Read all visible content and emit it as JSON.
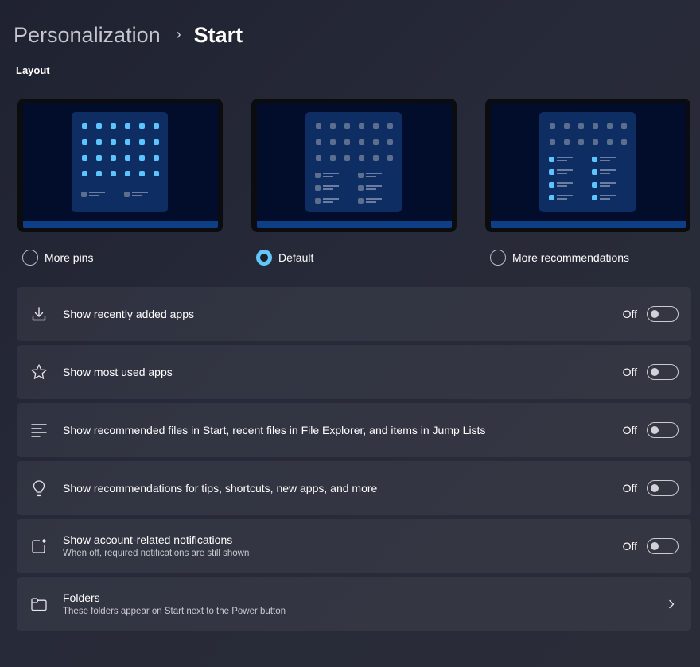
{
  "breadcrumb": {
    "parent": "Personalization",
    "separator": "›",
    "current": "Start"
  },
  "layout": {
    "section_title": "Layout",
    "options": [
      {
        "label": "More pins",
        "selected": false
      },
      {
        "label": "Default",
        "selected": true
      },
      {
        "label": "More recommendations",
        "selected": false
      }
    ]
  },
  "settings": [
    {
      "title": "Show recently added apps",
      "state": "Off",
      "icon": "download-icon"
    },
    {
      "title": "Show most used apps",
      "state": "Off",
      "icon": "star-icon"
    },
    {
      "title": "Show recommended files in Start, recent files in File Explorer, and items in Jump Lists",
      "state": "Off",
      "icon": "list-icon"
    },
    {
      "title": "Show recommendations for tips, shortcuts, new apps, and more",
      "state": "Off",
      "icon": "lightbulb-icon"
    },
    {
      "title": "Show account-related notifications",
      "subtitle": "When off, required notifications are still shown",
      "state": "Off",
      "icon": "notification-badge-icon"
    },
    {
      "title": "Folders",
      "subtitle": "These folders appear on Start next to the Power button",
      "icon": "folder-icon"
    }
  ],
  "colors": {
    "accent": "#62c5fb",
    "background": "#23263a",
    "card": "#2f3140"
  }
}
